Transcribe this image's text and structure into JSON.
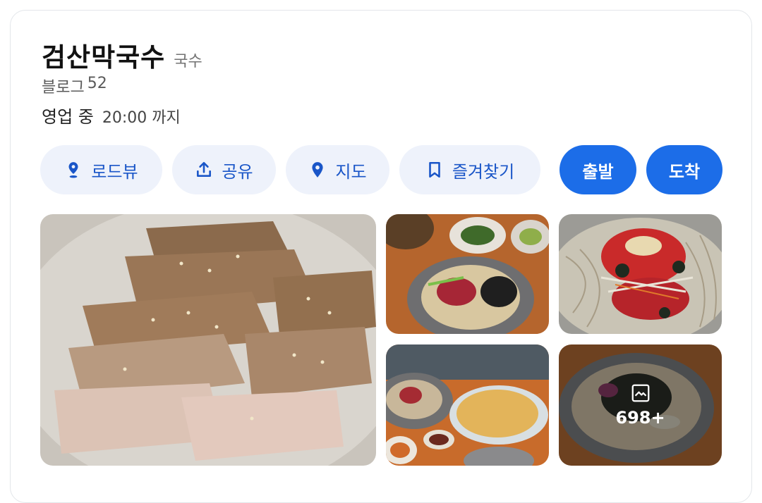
{
  "place": {
    "name": "검산막국수",
    "category": "국수",
    "blog_label": "블로그",
    "blog_count": "52",
    "status": "영업 중",
    "hours": "20:00 까지"
  },
  "actions": {
    "roadview": {
      "label": "로드뷰",
      "icon": "roadview-pin-icon"
    },
    "share": {
      "label": "공유",
      "icon": "share-icon"
    },
    "map": {
      "label": "지도",
      "icon": "map-pin-icon"
    },
    "favorite": {
      "label": "즐겨찾기",
      "icon": "bookmark-icon"
    },
    "depart": {
      "label": "출발"
    },
    "arrive": {
      "label": "도착"
    }
  },
  "photos": {
    "more_count": "698+",
    "more_icon": "gallery-icon"
  },
  "colors": {
    "primary": "#1c6de8",
    "action_bg": "#eef2fb",
    "action_text": "#1a56c8"
  }
}
